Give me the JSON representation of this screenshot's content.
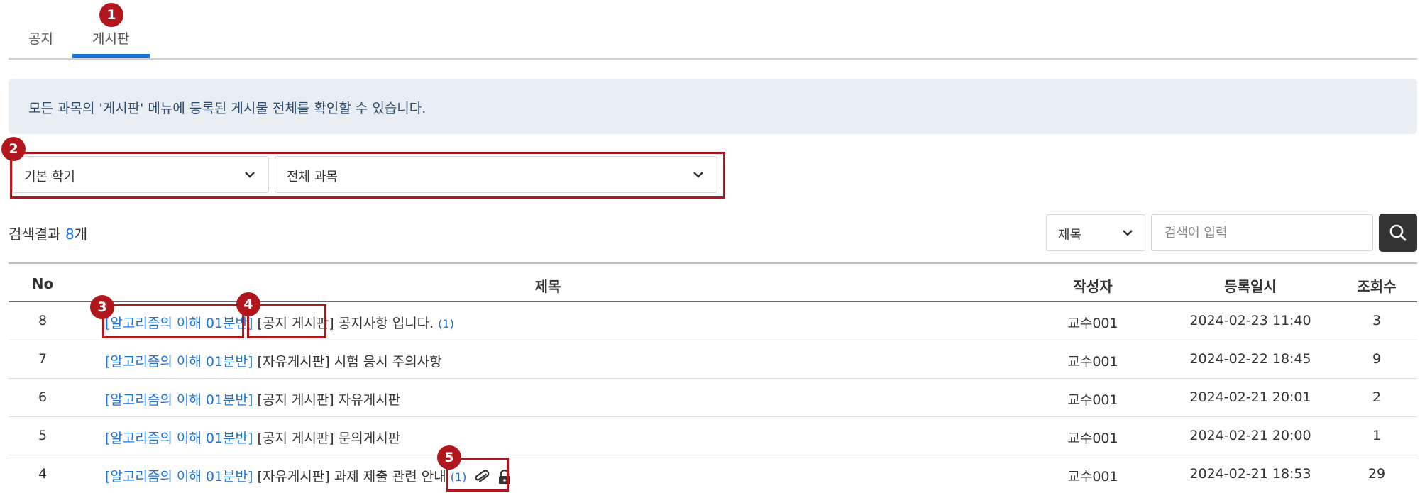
{
  "tabs": [
    {
      "label": "공지"
    },
    {
      "label": "게시판"
    }
  ],
  "info_text": "모든 과목의 '게시판' 메뉴에 등록된 게시물 전체를 확인할 수 있습니다.",
  "filters": {
    "semester_selected": "기본 학기",
    "course_selected": "전체 과목"
  },
  "results": {
    "prefix": "검색결과 ",
    "count": "8",
    "suffix": "개"
  },
  "search": {
    "type_selected": "제목",
    "placeholder": "검색어 입력"
  },
  "table": {
    "headers": {
      "no": "No",
      "title": "제목",
      "author": "작성자",
      "date": "등록일시",
      "views": "조회수"
    },
    "rows": [
      {
        "no": "8",
        "course": "[알고리즘의 이해 01분반]",
        "board": "[공지 게시판]",
        "title": "공지사항 입니다.",
        "comments": "(1)",
        "author": "교수001",
        "date": "2024-02-23 11:40",
        "views": "3"
      },
      {
        "no": "7",
        "course": "[알고리즘의 이해 01분반]",
        "board": "[자유게시판]",
        "title": "시험 응시 주의사항",
        "comments": "",
        "author": "교수001",
        "date": "2024-02-22 18:45",
        "views": "9"
      },
      {
        "no": "6",
        "course": "[알고리즘의 이해 01분반]",
        "board": "[공지 게시판]",
        "title": "자유게시판",
        "comments": "",
        "author": "교수001",
        "date": "2024-02-21 20:01",
        "views": "2"
      },
      {
        "no": "5",
        "course": "[알고리즘의 이해 01분반]",
        "board": "[공지 게시판]",
        "title": "문의게시판",
        "comments": "",
        "author": "교수001",
        "date": "2024-02-21 20:00",
        "views": "1"
      },
      {
        "no": "4",
        "course": "[알고리즘의 이해 01분반]",
        "board": "[자유게시판]",
        "title": "과제 제출 관련 안내",
        "comments": "(1)",
        "author": "교수001",
        "date": "2024-02-21 18:53",
        "views": "29"
      }
    ]
  },
  "annotations": [
    "1",
    "2",
    "3",
    "4",
    "5"
  ],
  "icons": {
    "attachment": "paperclip-icon",
    "locked": "lock-icon",
    "search": "search-icon",
    "dropdown": "chevron-down-icon"
  },
  "colors": {
    "accent": "#1a73d9",
    "annotation": "#b0161b",
    "info_bg": "#e9eef2",
    "search_button": "#333333"
  }
}
